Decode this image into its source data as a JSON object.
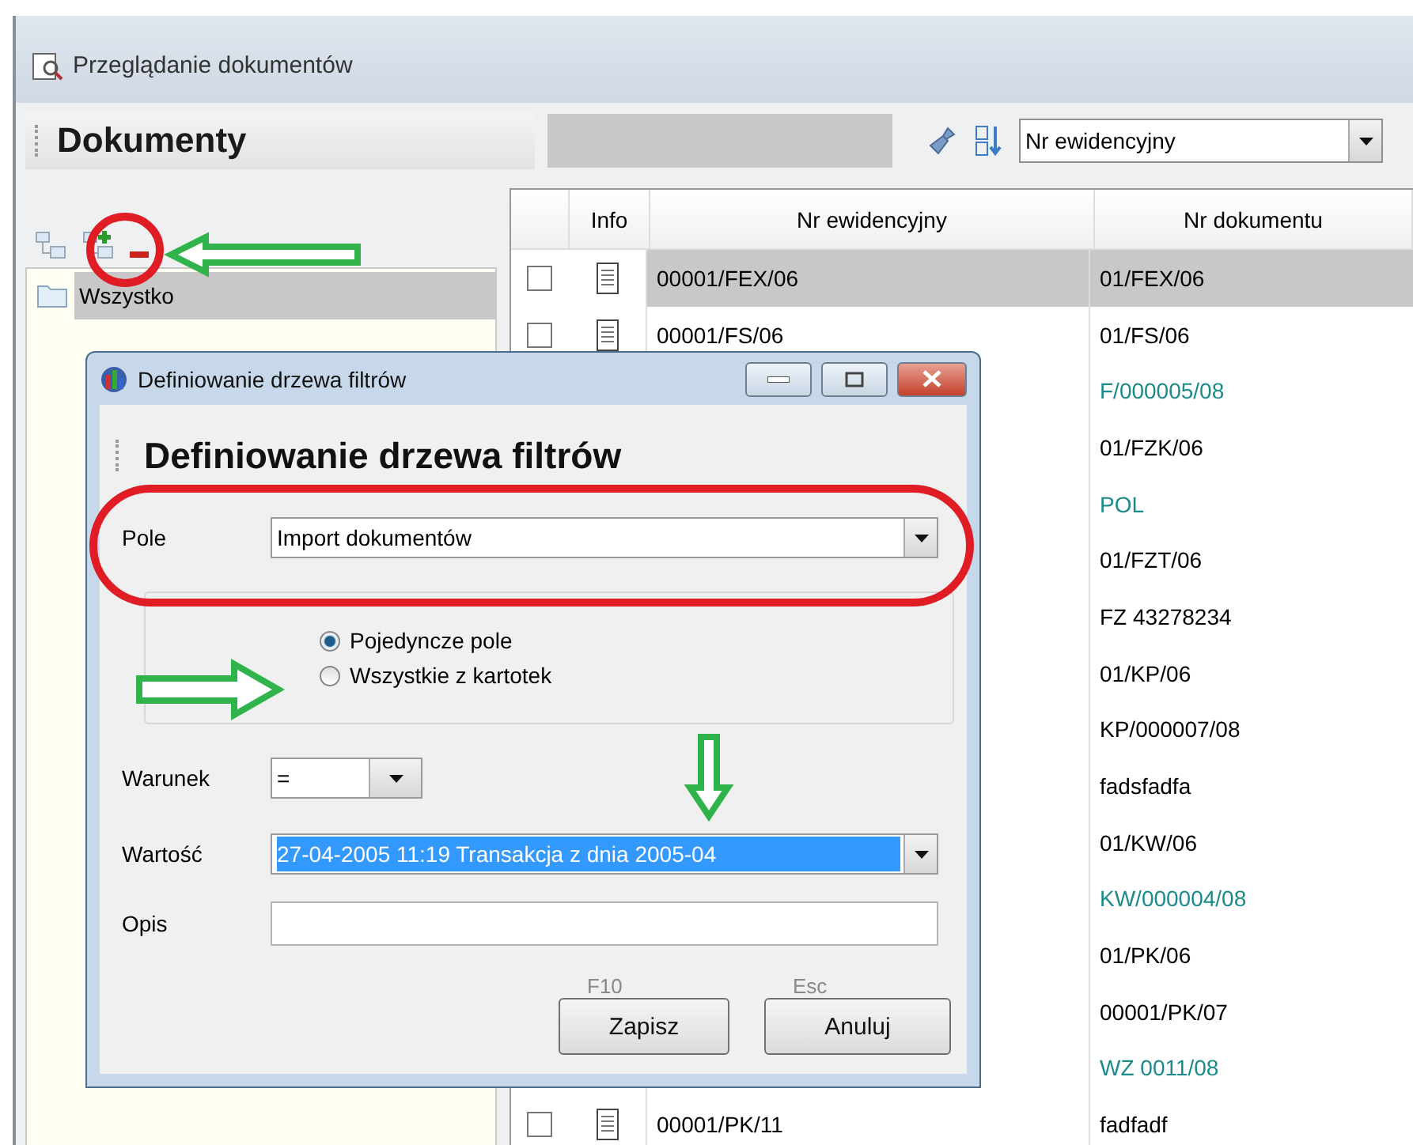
{
  "window": {
    "title": "Przeglądanie dokumentów"
  },
  "header": {
    "title": "Dokumenty",
    "sort_field": "Nr ewidencyjny"
  },
  "tree": {
    "items": [
      {
        "label": "Wszystko",
        "selected": true
      }
    ]
  },
  "table": {
    "columns": [
      "Info",
      "Nr ewidencyjny",
      "Nr dokumentu"
    ],
    "rows": [
      {
        "checked": false,
        "nr_ewidencyjny": "00001/FEX/06",
        "nr_dokumentu": "01/FEX/06",
        "selected": true,
        "color": "#000000"
      },
      {
        "checked": false,
        "nr_ewidencyjny": "00001/FS/06",
        "nr_dokumentu": "01/FS/06",
        "selected": false,
        "color": "#000000"
      },
      {
        "nr_dokumentu": "F/000005/08",
        "selected": false,
        "color": "#1a8a8a"
      },
      {
        "nr_dokumentu": "01/FZK/06",
        "selected": false,
        "color": "#000000"
      },
      {
        "nr_dokumentu": "POL",
        "selected": false,
        "color": "#1a8a8a"
      },
      {
        "nr_dokumentu": "01/FZT/06",
        "selected": false,
        "color": "#000000"
      },
      {
        "nr_dokumentu": "FZ 43278234",
        "selected": false,
        "color": "#000000"
      },
      {
        "nr_dokumentu": "01/KP/06",
        "selected": false,
        "color": "#000000"
      },
      {
        "nr_dokumentu": "KP/000007/08",
        "selected": false,
        "color": "#000000"
      },
      {
        "nr_dokumentu": "fadsfadfa",
        "selected": false,
        "color": "#000000"
      },
      {
        "nr_dokumentu": "01/KW/06",
        "selected": false,
        "color": "#000000"
      },
      {
        "nr_dokumentu": "KW/000004/08",
        "selected": false,
        "color": "#1a8a8a"
      },
      {
        "nr_dokumentu": "01/PK/06",
        "selected": false,
        "color": "#000000"
      },
      {
        "nr_dokumentu": "00001/PK/07",
        "selected": false,
        "color": "#000000"
      },
      {
        "nr_dokumentu": "WZ 0011/08",
        "selected": false,
        "color": "#1a8a8a"
      },
      {
        "checked": false,
        "nr_ewidencyjny": "00001/PK/11",
        "nr_dokumentu": "fadfadf",
        "selected": false,
        "color": "#000000"
      }
    ]
  },
  "dialog": {
    "title": "Definiowanie drzewa filtrów",
    "heading": "Definiowanie drzewa filtrów",
    "pole": {
      "label": "Pole",
      "value": "Import dokumentów"
    },
    "radios": [
      {
        "label": "Pojedyncze pole",
        "selected": true
      },
      {
        "label": "Wszystkie z kartotek",
        "selected": false
      }
    ],
    "warunek": {
      "label": "Warunek",
      "value": "="
    },
    "wartosc": {
      "label": "Wartość",
      "value": "27-04-2005 11:19 Transakcja z dnia 2005-04"
    },
    "opis": {
      "label": "Opis"
    },
    "buttons": [
      {
        "shortcut": "F10",
        "label": "Zapisz"
      },
      {
        "shortcut": "Esc",
        "label": "Anuluj"
      }
    ]
  }
}
